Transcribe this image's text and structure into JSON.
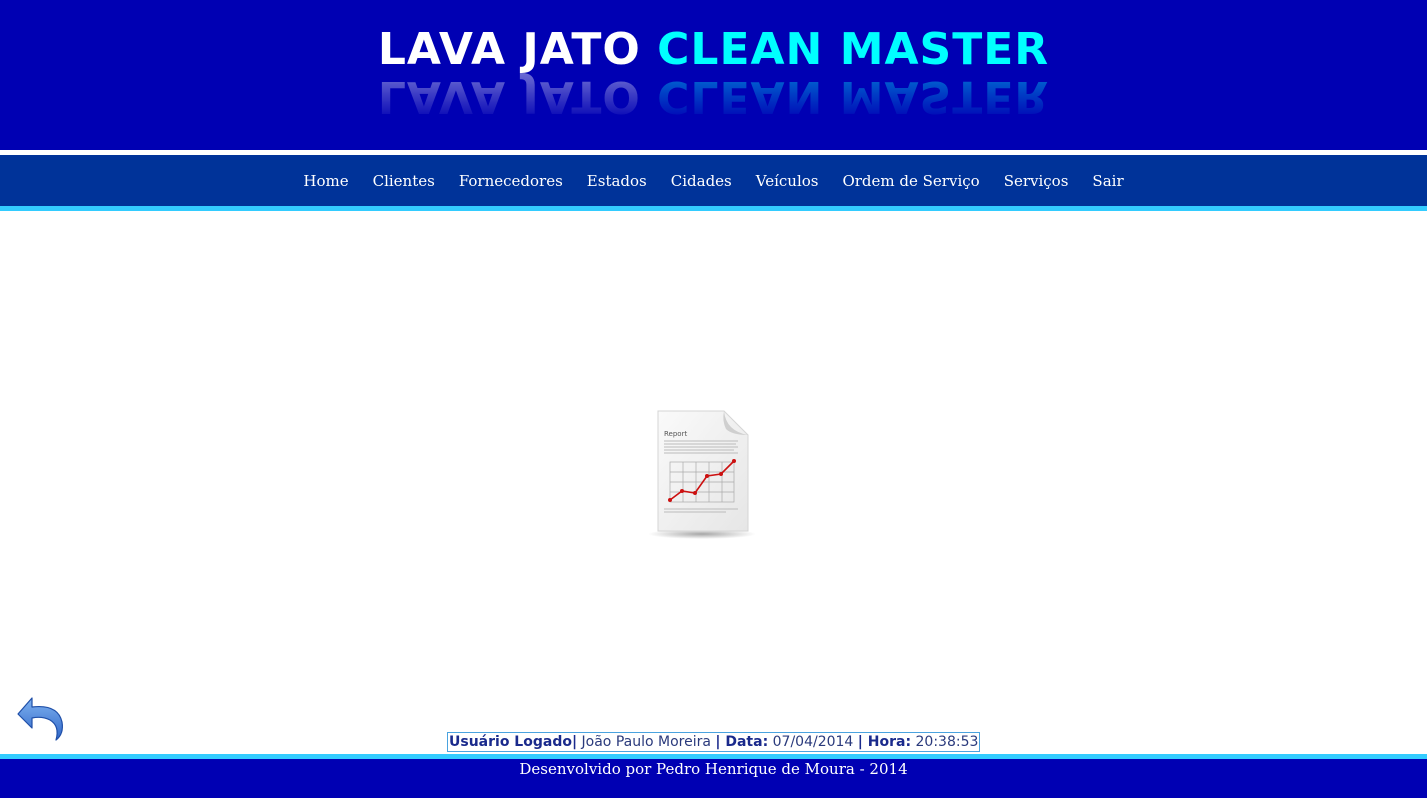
{
  "header": {
    "logo_part1": "LAVA JATO",
    "logo_part2": "CLEAN MASTER"
  },
  "nav": {
    "items": [
      {
        "label": "Home"
      },
      {
        "label": "Clientes"
      },
      {
        "label": "Fornecedores"
      },
      {
        "label": "Estados"
      },
      {
        "label": "Cidades"
      },
      {
        "label": "Veículos"
      },
      {
        "label": "Ordem de Serviço"
      },
      {
        "label": "Serviços"
      },
      {
        "label": "Sair"
      }
    ]
  },
  "main": {
    "report_icon": "report-document-icon",
    "report_title": "Report"
  },
  "back": {
    "icon": "undo-arrow-icon"
  },
  "status": {
    "user_label": "Usuário Logado|",
    "user_value": "João Paulo Moreira",
    "date_label": "| Data:",
    "date_value": "07/04/2014",
    "time_label": "| Hora:",
    "time_value": "20:38:53"
  },
  "footer": {
    "text": "Desenvolvido por Pedro Henrique de Moura - 2014"
  },
  "colors": {
    "banner": "#0000b3",
    "nav": "#003399",
    "accent_stripe": "#33ccff",
    "logo_cyan": "#00ffff"
  }
}
